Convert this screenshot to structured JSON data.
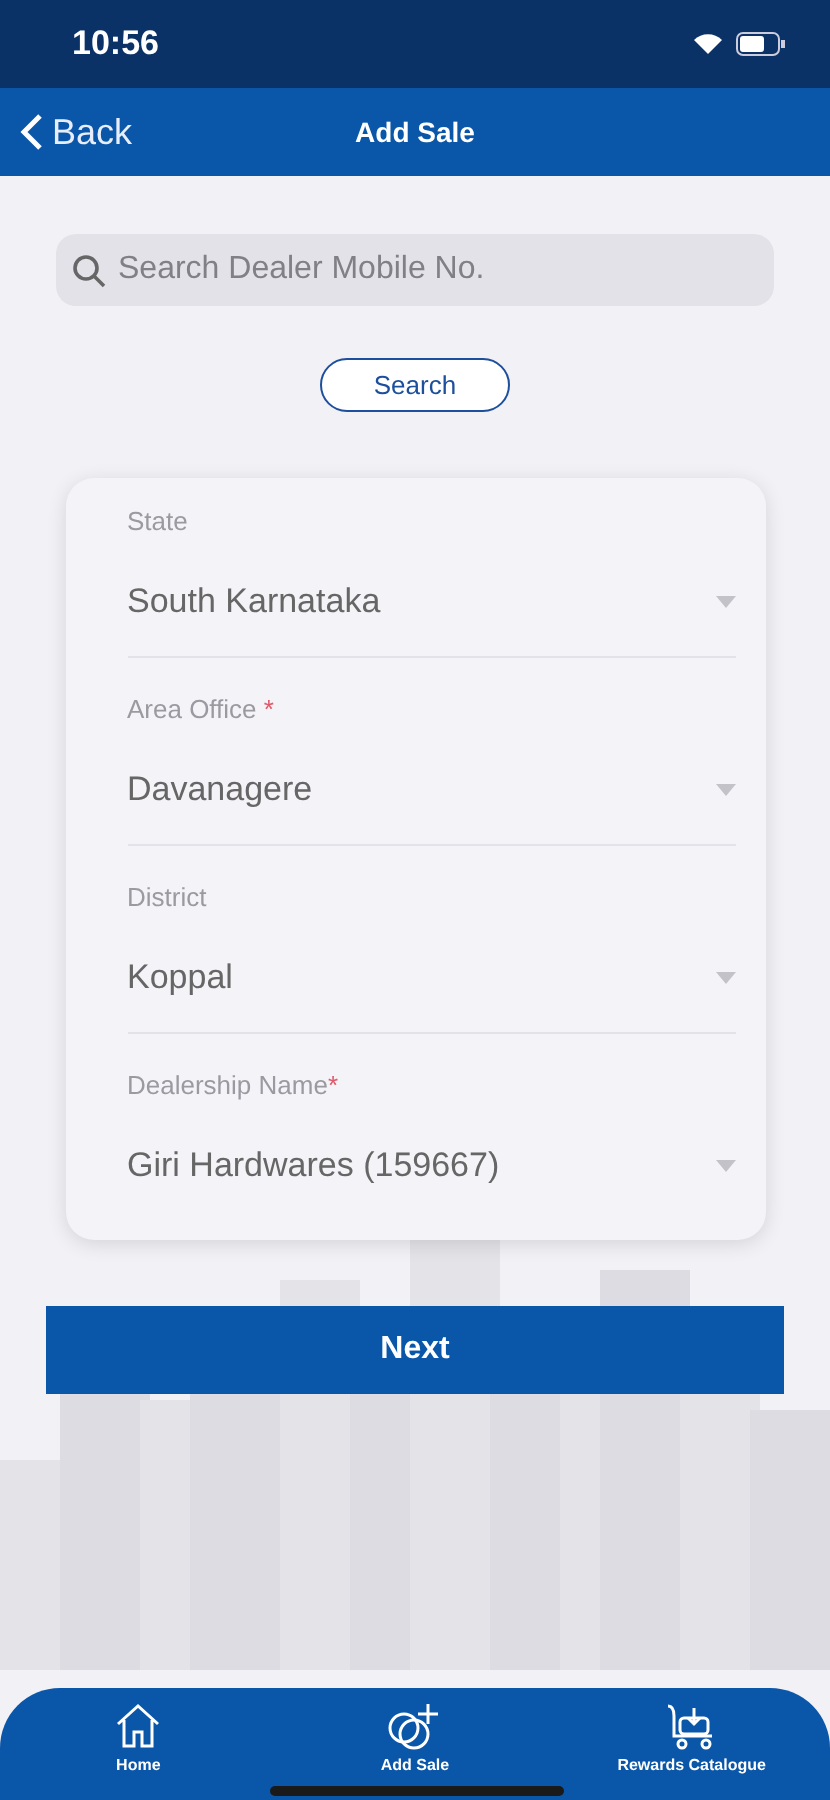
{
  "status_bar": {
    "time": "10:56"
  },
  "nav_bar": {
    "back": "Back",
    "title": "Add Sale"
  },
  "search": {
    "placeholder": "Search Dealer Mobile No.",
    "button": "Search"
  },
  "fields": [
    {
      "label": "State",
      "value": "South Karnataka"
    },
    {
      "label": "Area Office",
      "required_mark": " *",
      "value": "Davanagere"
    },
    {
      "label": "District",
      "value": "Koppal"
    },
    {
      "label": "Dealership Name",
      "required_mark": "*",
      "value": "Giri Hardwares (159667)"
    }
  ],
  "next_button": "Next",
  "tab_bar": [
    {
      "label": "Home"
    },
    {
      "label": "Add Sale"
    },
    {
      "label": "Rewards Catalogue"
    }
  ]
}
